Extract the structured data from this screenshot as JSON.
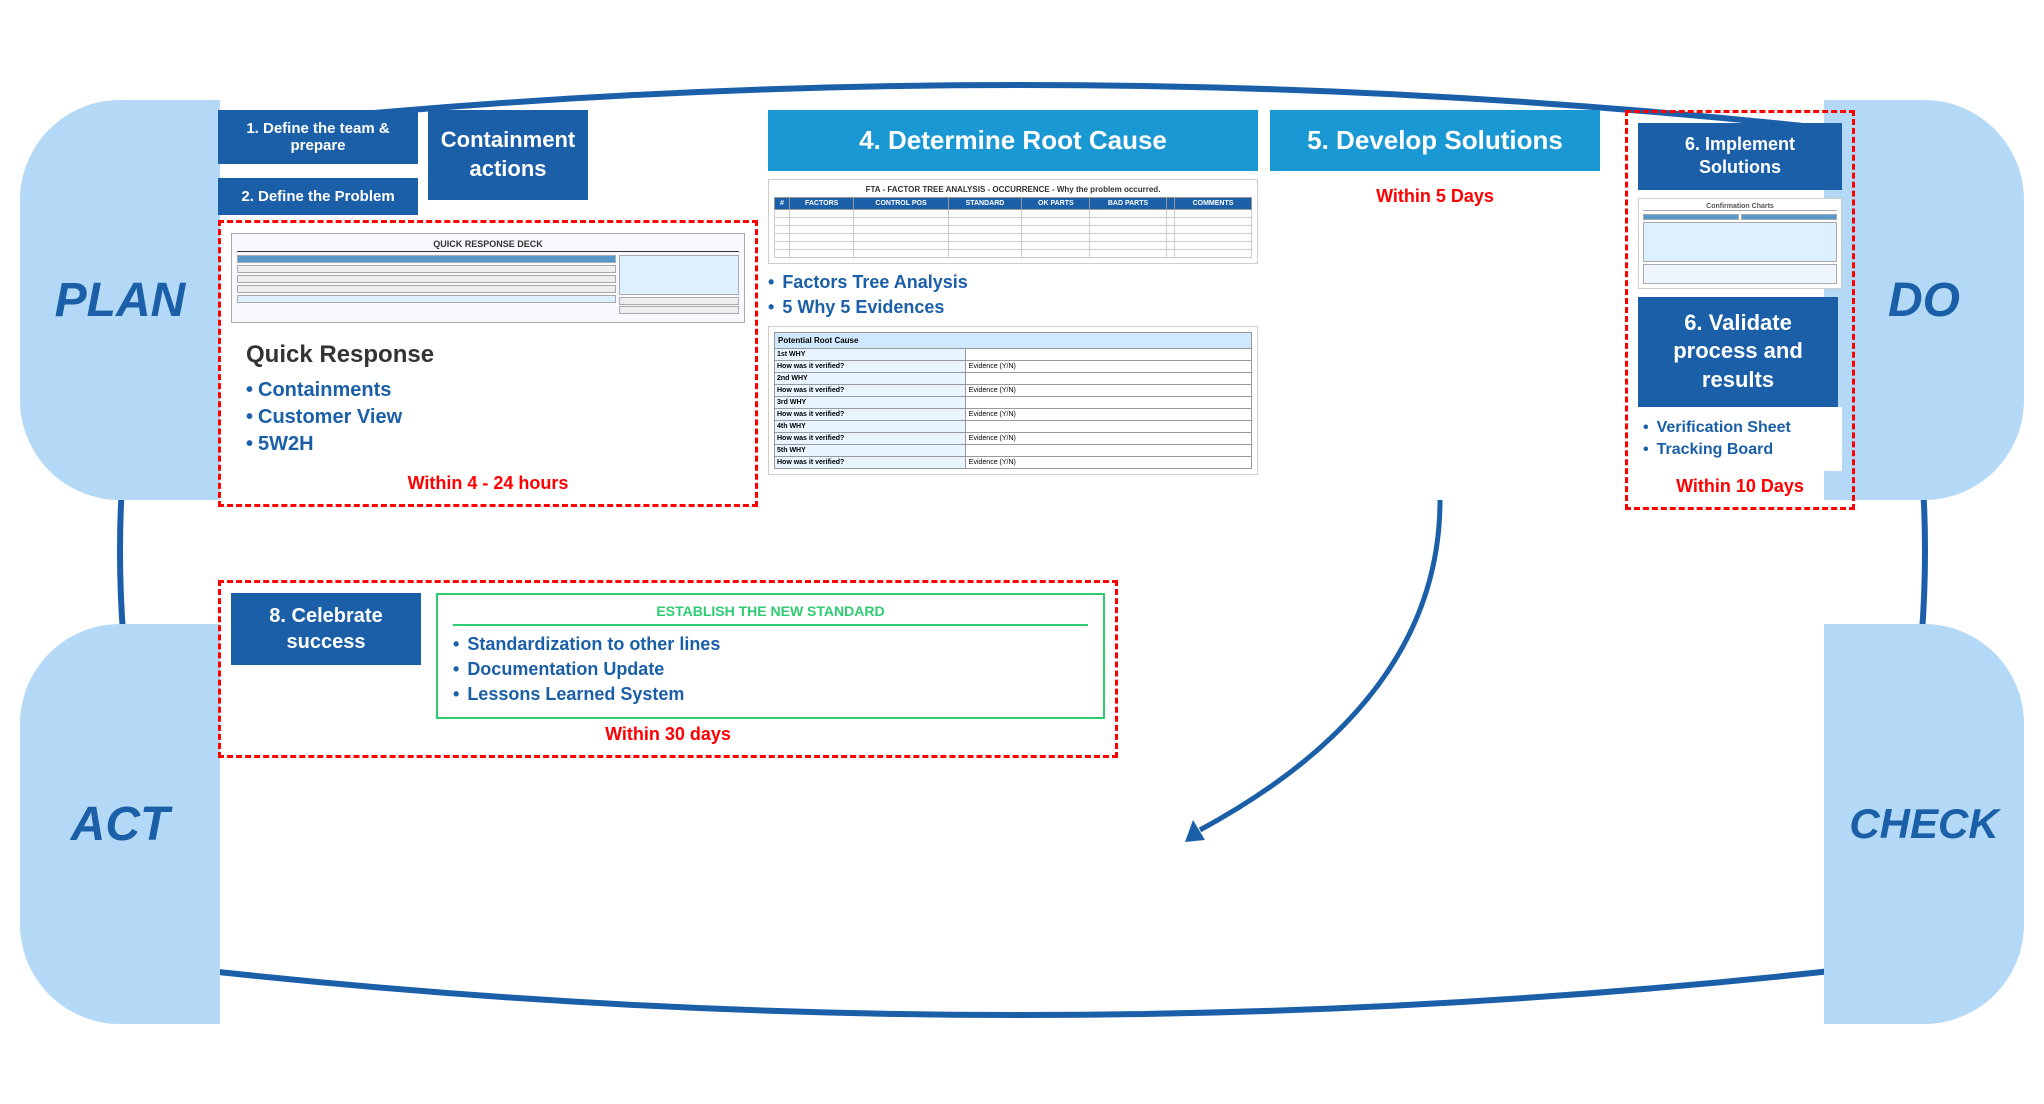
{
  "plan": {
    "label": "PLAN"
  },
  "do": {
    "label": "DO"
  },
  "act": {
    "label": "ACT"
  },
  "check": {
    "label": "CHECK"
  },
  "step1": {
    "label": "1. Define the team & prepare"
  },
  "step2": {
    "label": "2. Define the Problem"
  },
  "step3": {
    "label": "Containment actions"
  },
  "step4": {
    "label": "4. Determine Root Cause"
  },
  "step5": {
    "label": "5. Develop Solutions"
  },
  "step6_implement": {
    "label": "6. Implement Solutions"
  },
  "step6_validate": {
    "label": "6. Validate process and results"
  },
  "step8": {
    "label": "8. Celebrate success"
  },
  "quick_response": {
    "title": "Quick Response",
    "items": [
      "Containments",
      "Customer View",
      "5W2H"
    ]
  },
  "within_4_24": {
    "label": "Within 4 - 24 hours"
  },
  "within_5_days": {
    "label": "Within 5 Days"
  },
  "within_30_days": {
    "label": "Within 30 days"
  },
  "within_10_days": {
    "label": "Within 10 Days"
  },
  "root_cause": {
    "bullet1": "Factors Tree Analysis",
    "bullet2": "5 Why 5 Evidences"
  },
  "validate": {
    "bullet1": "Verification Sheet",
    "bullet2": "Tracking Board"
  },
  "standardize": {
    "title": "ESTABLISH THE NEW STANDARD",
    "bullet1": "Standardization to other lines",
    "bullet2": "Documentation Update",
    "bullet3": "Lessons Learned System"
  },
  "fta_table": {
    "headers": [
      "#",
      "FACTORS",
      "CONTROL POS",
      "STANDARD",
      "OK PARTS",
      "BAD PARTS",
      "",
      "COMMENTS"
    ],
    "rows_count": 6
  },
  "why_table": {
    "header": "Potential Root Cause",
    "rows": [
      {
        "label": "1st WHY",
        "value": ""
      },
      {
        "label": "How was it verified?",
        "value": "Evidence (Y/N)"
      },
      {
        "label": "2nd WHY",
        "value": ""
      },
      {
        "label": "How was it verified?",
        "value": "Evidence (Y/N)"
      },
      {
        "label": "3rd WHY",
        "value": ""
      },
      {
        "label": "How was it verified?",
        "value": "Evidence (Y/N)"
      },
      {
        "label": "4th WHY",
        "value": ""
      },
      {
        "label": "How was it verified?",
        "value": "Evidence (Y/N)"
      },
      {
        "label": "5th WHY",
        "value": ""
      },
      {
        "label": "How was it verified?",
        "value": "Evidence (Y/N)"
      }
    ]
  },
  "colors": {
    "dark_blue": "#1a5fa8",
    "light_blue": "#1a98d4",
    "circle_blue": "#b3d9f7",
    "red_dashed": "red",
    "green": "#2ecc71"
  }
}
